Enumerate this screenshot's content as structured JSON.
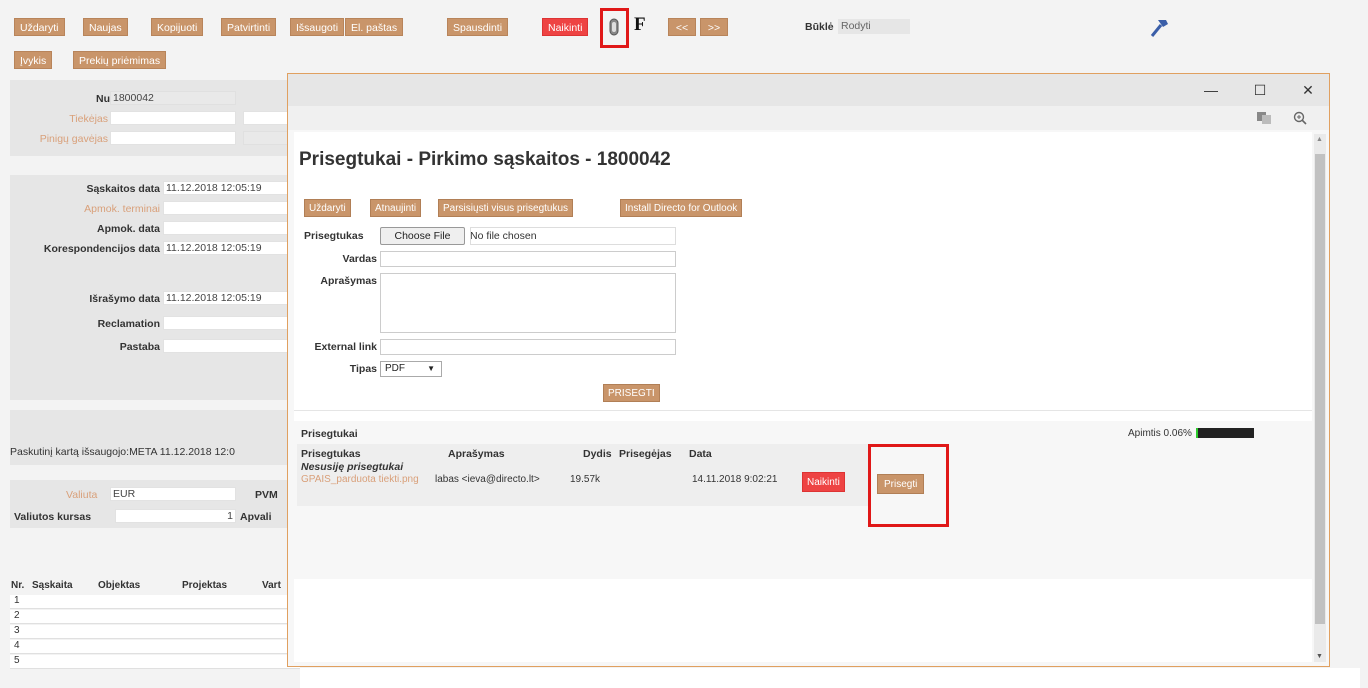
{
  "toolbar": {
    "buttons": [
      "Uždaryti",
      "Naujas",
      "Kopijuoti",
      "Patvirtinti",
      "Išsaugoti",
      "El. paštas",
      "Spausdinti",
      "Naikinti"
    ],
    "f_label": "F",
    "prev": "<<",
    "next": ">>",
    "row2": [
      "Įvykis",
      "Prekių priėmimas"
    ],
    "state_label": "Būklė",
    "state_value": "Rodyti"
  },
  "form": {
    "numeris_label": "Numeris",
    "numeris_value": "1800042",
    "tiekejas_label": "Tiekėjas",
    "pinigu_label": "Pinigų gavėjas",
    "saskaitos_data_label": "Sąskaitos data",
    "saskaitos_data_value": "11.12.2018 12:05:19",
    "apmok_terminai_label": "Apmok. terminai",
    "apmok_data_label": "Apmok. data",
    "koresp_label": "Korespondencijos data",
    "koresp_value": "11.12.2018 12:05:19",
    "israsymo_label": "Išrašymo data",
    "israsymo_value": "11.12.2018 12:05:19",
    "reclamation_label": "Reclamation",
    "pastaba_label": "Pastaba",
    "last_saved": "Paskutinį kartą išsaugojo:META 11.12.2018 12:0",
    "valiuta_label": "Valiuta",
    "valiuta_value": "EUR",
    "pvm_label": "PVM",
    "kursas_label": "Valiutos kursas",
    "kursas_value": "1",
    "apvalinimas_label": "Apvali"
  },
  "grid": {
    "headers": [
      "Nr.",
      "Sąskaita",
      "Objektas",
      "Projektas",
      "Vart"
    ],
    "rows": [
      "1",
      "2",
      "3",
      "4",
      "5"
    ]
  },
  "dialog": {
    "minimize": "—",
    "maximize": "☐",
    "close": "✕",
    "title": "Prisegtukai - Pirkimo sąskaitos - 1800042",
    "buttons": [
      "Uždaryti",
      "Atnaujinti",
      "Parsisiųsti visus prisegtukus",
      "Install Directo for Outlook"
    ],
    "prisegtukas_label": "Prisegtukas",
    "choose_file": "Choose File",
    "no_file": "No file chosen",
    "vardas_label": "Vardas",
    "aprasymas_label": "Aprašymas",
    "external_label": "External link",
    "tipas_label": "Tipas",
    "tipas_value": "PDF",
    "prisegti_button": "PRISEGTI",
    "section_title": "Prisegtukai",
    "apimtis_label": "Apimtis 0.06%",
    "apimtis_fraction": 0.06,
    "table_headers": [
      "Prisegtukas",
      "Aprašymas",
      "Dydis",
      "Prisegėjas",
      "Data"
    ],
    "group_label": "Nesusiję prisegtukai",
    "file_name": "GPAIS_parduota tiekti.png",
    "file_desc": "labas <ieva@directo.lt>",
    "file_size": "19.57k",
    "file_date": "14.11.2018 9:02:21",
    "delete_button": "Naikinti",
    "attach_button": "Prisegti"
  },
  "colors": {
    "accent": "#c9956a",
    "danger": "#ee4343",
    "highlight": "#e01818",
    "link": "#d9a07a"
  }
}
